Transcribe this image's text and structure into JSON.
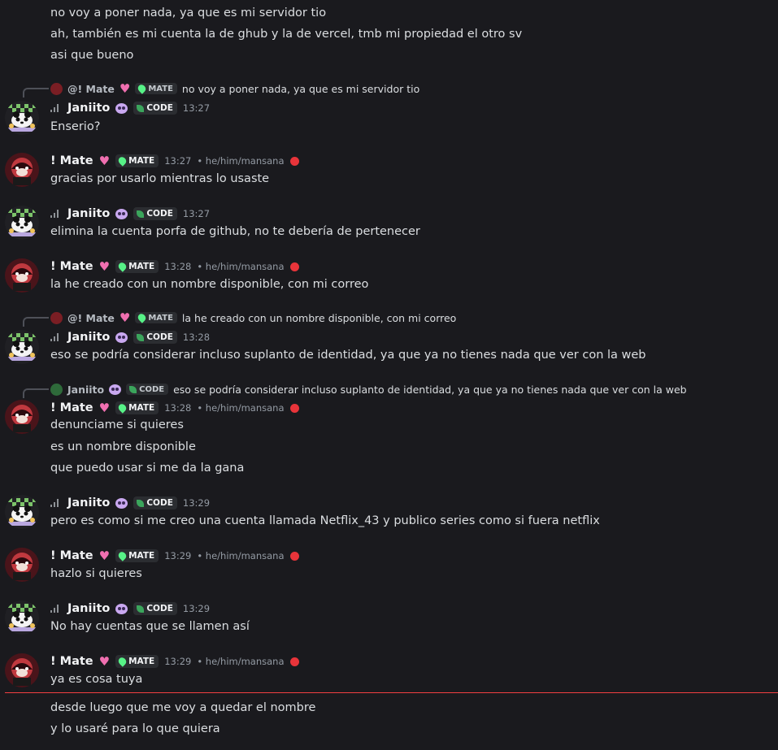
{
  "lines": {
    "l1": "no voy a poner nada, ya que es mi servidor tio",
    "l2": "ah, también es mi cuenta la de ghub y la de vercel, tmb mi propiedad el otro sv",
    "l3": "asi que bueno",
    "m1": "Enserio?",
    "m2": "gracias por usarlo mientras lo usaste",
    "m3": "elimina la cuenta porfa de github, no te debería de pertenecer",
    "m4": "la he creado con un nombre disponible, con mi correo",
    "m5": "eso se podría considerar incluso suplanto de identidad, ya que ya no tienes nada que ver con la web",
    "m6a": "denunciame si quieres",
    "m6b": "es un nombre disponible",
    "m6c": "que puedo usar si me da la gana",
    "m7": "pero es como si me creo una cuenta llamada Netflix_43 y publico series como si fuera netflix",
    "m8": "hazlo si quieres",
    "m9": "No hay cuentas que se llamen así",
    "m10": "ya es cosa tuya",
    "m11a": "desde luego que me voy a quedar el nombre",
    "m11b": "y lo usaré para lo que quiera"
  },
  "users": {
    "janiito": {
      "name": "Janiito",
      "tag": "CODE"
    },
    "mate": {
      "name": "! Mate",
      "tag": "MATE",
      "pronouns": "• he/him/mansana"
    },
    "mate_reply": {
      "name": "@! Mate"
    }
  },
  "times": {
    "t1": "13:27",
    "t2": "13:27",
    "t3": "13:27",
    "t4": "13:28",
    "t5": "13:28",
    "t6": "13:28",
    "t7": "13:29",
    "t8": "13:29",
    "t9": "13:29",
    "t10": "13:29"
  },
  "replies": {
    "r1": "no voy a poner nada, ya que es mi servidor tio",
    "r2": "la he creado con un nombre disponible, con mi correo",
    "r3": "eso se podría considerar incluso suplanto de identidad, ya que ya no tienes nada que ver con la web"
  },
  "colors": {
    "background": "#1a1a1e",
    "new_divider": "#f23f42",
    "tag_bg": "#2b2d31"
  },
  "icons": [
    "signal-bars-icon",
    "leaf-icon",
    "drop-icon",
    "heart-icon",
    "apple-icon",
    "panda-emoji-icon"
  ]
}
